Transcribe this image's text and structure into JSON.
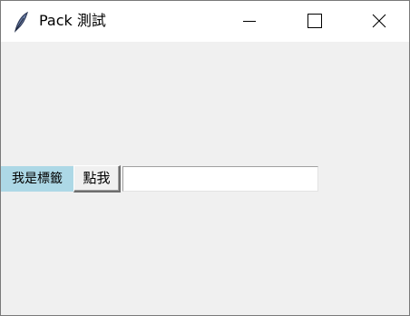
{
  "window": {
    "title": "Pack 測試",
    "icon": "feather-icon",
    "controls": [
      "minimize-icon",
      "maximize-icon",
      "close-icon"
    ]
  },
  "content": {
    "label_text": "我是標籤",
    "label_bg": "#add8e6",
    "button_label": "點我",
    "entry_value": ""
  }
}
